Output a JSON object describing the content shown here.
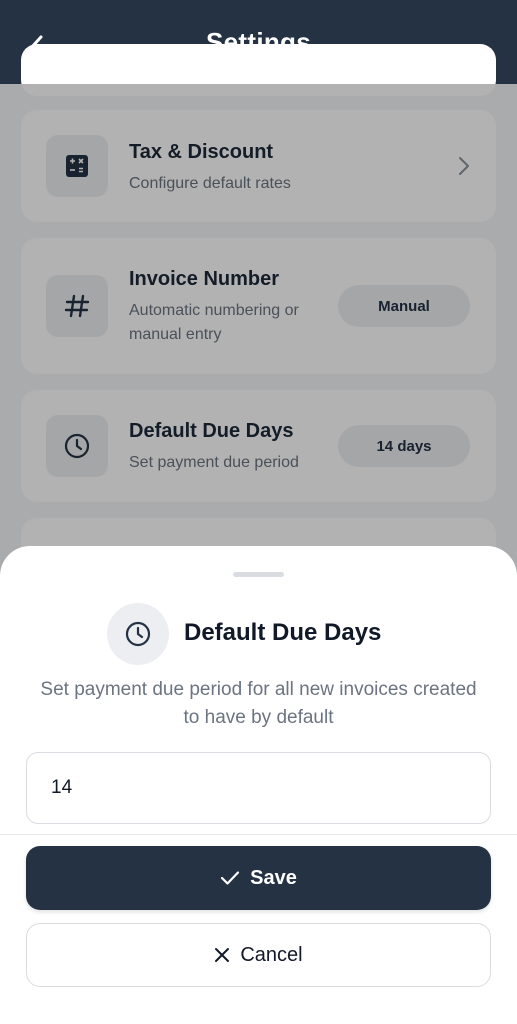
{
  "header": {
    "title": "Settings",
    "back_icon": "chevron-left-icon"
  },
  "settings": {
    "tax_discount": {
      "title": "Tax & Discount",
      "subtitle": "Configure default rates",
      "icon": "calculator-icon"
    },
    "invoice_number": {
      "title": "Invoice Number",
      "subtitle_line1": "Automatic numbering or",
      "subtitle_line2": "manual entry",
      "value": "Manual",
      "icon": "hash-icon"
    },
    "due_days": {
      "title": "Default Due Days",
      "subtitle": "Set payment due period",
      "value": "14 days",
      "icon": "clock-icon"
    }
  },
  "sheet": {
    "title": "Default Due Days",
    "description": "Set payment due period for all new invoices created to have by default",
    "input_value": "14",
    "save_label": "Save",
    "cancel_label": "Cancel"
  },
  "colors": {
    "primary": "#243244",
    "overlay": "rgba(0,0,0,0.30)",
    "muted_text": "#6b7480"
  }
}
